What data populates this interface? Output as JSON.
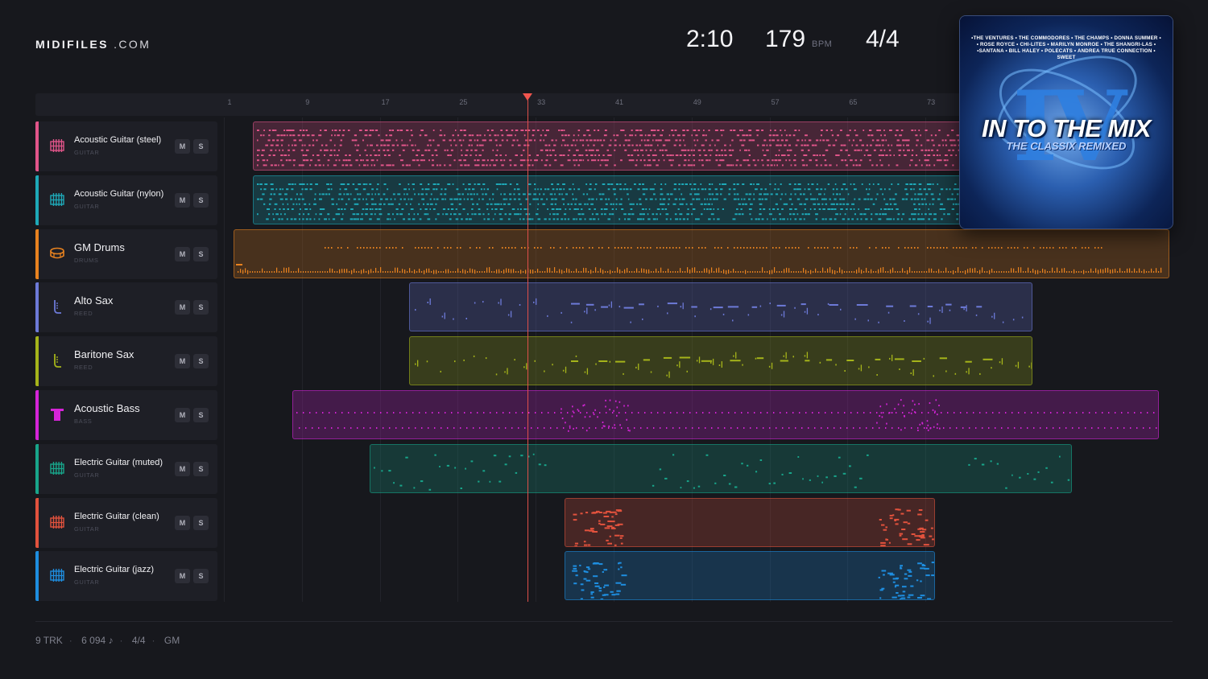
{
  "brand": {
    "name_bold": "MIDIFILES",
    "name_light": ".COM"
  },
  "transport": {
    "time": "2:10",
    "bpm": "179",
    "bpm_unit": "BPM",
    "meter": "4/4"
  },
  "album": {
    "artists_line1": "•THE VENTURES • THE COMMODORES • THE CHAMPS • DONNA SUMMER •",
    "artists_line2": "• ROSE ROYCE • CHI-LITES • MARILYN MONROE • THE SHANGRI-LAS •",
    "artists_line3": "•SANTANA • BILL HALEY • POLECATS • ANDREA TRUE CONNECTION • SWEET",
    "roman": "IV",
    "title": "IN TO THE MIX",
    "subtitle": "THE CLASSIX REMIXED"
  },
  "ruler": {
    "bars": [
      "1",
      "9",
      "17",
      "25",
      "33",
      "41",
      "49",
      "57",
      "65",
      "73"
    ]
  },
  "playhead_position_bar": 31,
  "tracks": [
    {
      "name": "Acoustic Guitar (steel)",
      "category": "GUITAR",
      "icon": "guitar-grid-icon",
      "color": "#e2558a",
      "mute": "M",
      "solo": "S",
      "clip_start_bar": 3,
      "clip_end_bar": 87,
      "notes": "dense"
    },
    {
      "name": "Acoustic Guitar (nylon)",
      "category": "GUITAR",
      "icon": "guitar-grid-icon",
      "color": "#1ea9b8",
      "mute": "M",
      "solo": "S",
      "clip_start_bar": 3,
      "clip_end_bar": 87,
      "notes": "dense"
    },
    {
      "name": "GM Drums",
      "category": "DRUMS",
      "icon": "drum-icon",
      "color": "#e8821f",
      "mute": "M",
      "solo": "S",
      "clip_start_bar": 1,
      "clip_end_bar": 97,
      "notes": "drums"
    },
    {
      "name": "Alto Sax",
      "category": "REED",
      "icon": "sax-icon",
      "color": "#6d7ad8",
      "mute": "M",
      "solo": "S",
      "clip_start_bar": 19,
      "clip_end_bar": 83,
      "notes": "sparse"
    },
    {
      "name": "Baritone Sax",
      "category": "REED",
      "icon": "sax-icon",
      "color": "#a5b41a",
      "mute": "M",
      "solo": "S",
      "clip_start_bar": 19,
      "clip_end_bar": 83,
      "notes": "sparse"
    },
    {
      "name": "Acoustic Bass",
      "category": "BASS",
      "icon": "bass-icon",
      "color": "#d524d8",
      "mute": "M",
      "solo": "S",
      "clip_start_bar": 7,
      "clip_end_bar": 96,
      "notes": "bass"
    },
    {
      "name": "Electric Guitar (muted)",
      "category": "GUITAR",
      "icon": "guitar-grid-icon",
      "color": "#18a58a",
      "mute": "M",
      "solo": "S",
      "clip_start_bar": 15,
      "clip_end_bar": 87,
      "notes": "scatter"
    },
    {
      "name": "Electric Guitar (clean)",
      "category": "GUITAR",
      "icon": "guitar-grid-icon",
      "color": "#e2523d",
      "mute": "M",
      "solo": "S",
      "clip_start_bar": 35,
      "clip_end_bar": 73,
      "notes": "bursts"
    },
    {
      "name": "Electric Guitar (jazz)",
      "category": "GUITAR",
      "icon": "guitar-grid-icon",
      "color": "#1e8ee0",
      "mute": "M",
      "solo": "S",
      "clip_start_bar": 35,
      "clip_end_bar": 73,
      "notes": "bursts"
    }
  ],
  "footer": {
    "tracks": "9 TRK",
    "notes": "6 094 ♪",
    "meter": "4/4",
    "standard": "GM"
  }
}
